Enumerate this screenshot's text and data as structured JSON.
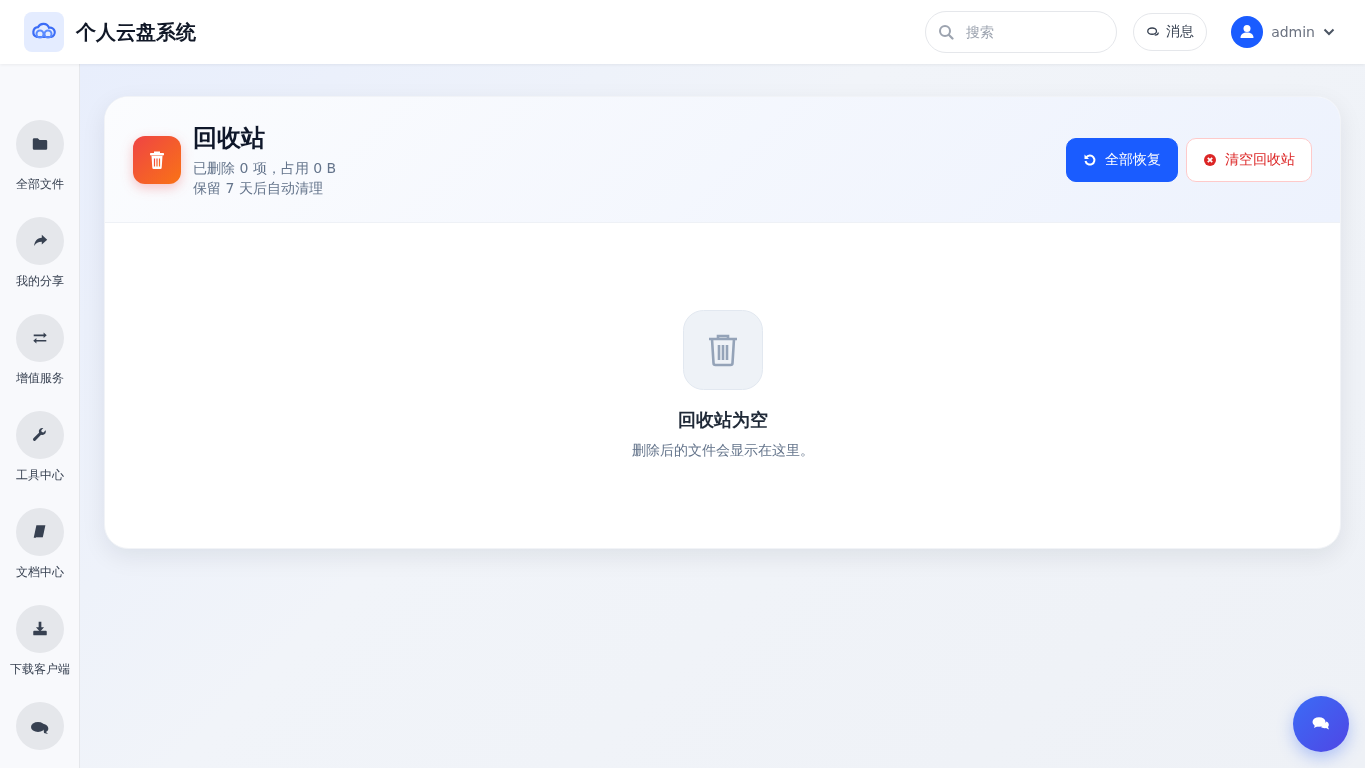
{
  "header": {
    "app_title": "个人云盘系统",
    "search": {
      "placeholder": "搜索"
    },
    "messages_button": "消息",
    "user": {
      "name": "admin"
    }
  },
  "sidebar": {
    "items": [
      {
        "label": "全部文件"
      },
      {
        "label": "我的分享"
      },
      {
        "label": "增值服务"
      },
      {
        "label": "工具中心"
      },
      {
        "label": "文档中心"
      },
      {
        "label": "下载客户端"
      }
    ]
  },
  "panel": {
    "title": "回收站",
    "summary": "已删除 0 项，占用 0 B",
    "retention": "保留 7 天后自动清理",
    "buttons": [
      {
        "label": "全部恢复",
        "kind": "primary"
      },
      {
        "label": "清空回收站",
        "kind": "danger"
      }
    ],
    "empty_state": {
      "title": "回收站为空",
      "message": "删除后的文件会显示在这里。"
    }
  }
}
